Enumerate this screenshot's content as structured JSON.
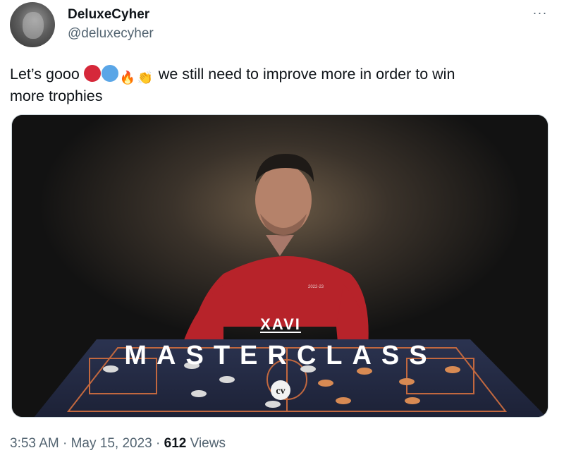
{
  "author": {
    "display_name": "DeluxeCyher",
    "handle": "@deluxecyher"
  },
  "more_icon": "···",
  "tweet": {
    "text_start": "Let’s gooo ",
    "emojis": [
      {
        "name": "red-circle-emoji",
        "glyph": ""
      },
      {
        "name": "blue-circle-emoji",
        "glyph": ""
      },
      {
        "name": "fire-emoji",
        "glyph": "🔥"
      },
      {
        "name": "clapping-hands-emoji",
        "glyph": "👏"
      }
    ],
    "text_rest_line1": " we still need to improve more in order to win",
    "text_line2": "more trophies"
  },
  "media": {
    "title_small": "XAVI",
    "title_large": "MASTERCLASS",
    "badge": "cv",
    "shirt_text": "2022-23"
  },
  "meta": {
    "time": "3:53 AM",
    "sep1": " · ",
    "date": "May 15, 2023",
    "sep2": " · ",
    "views_count": "612",
    "views_label": " Views"
  }
}
